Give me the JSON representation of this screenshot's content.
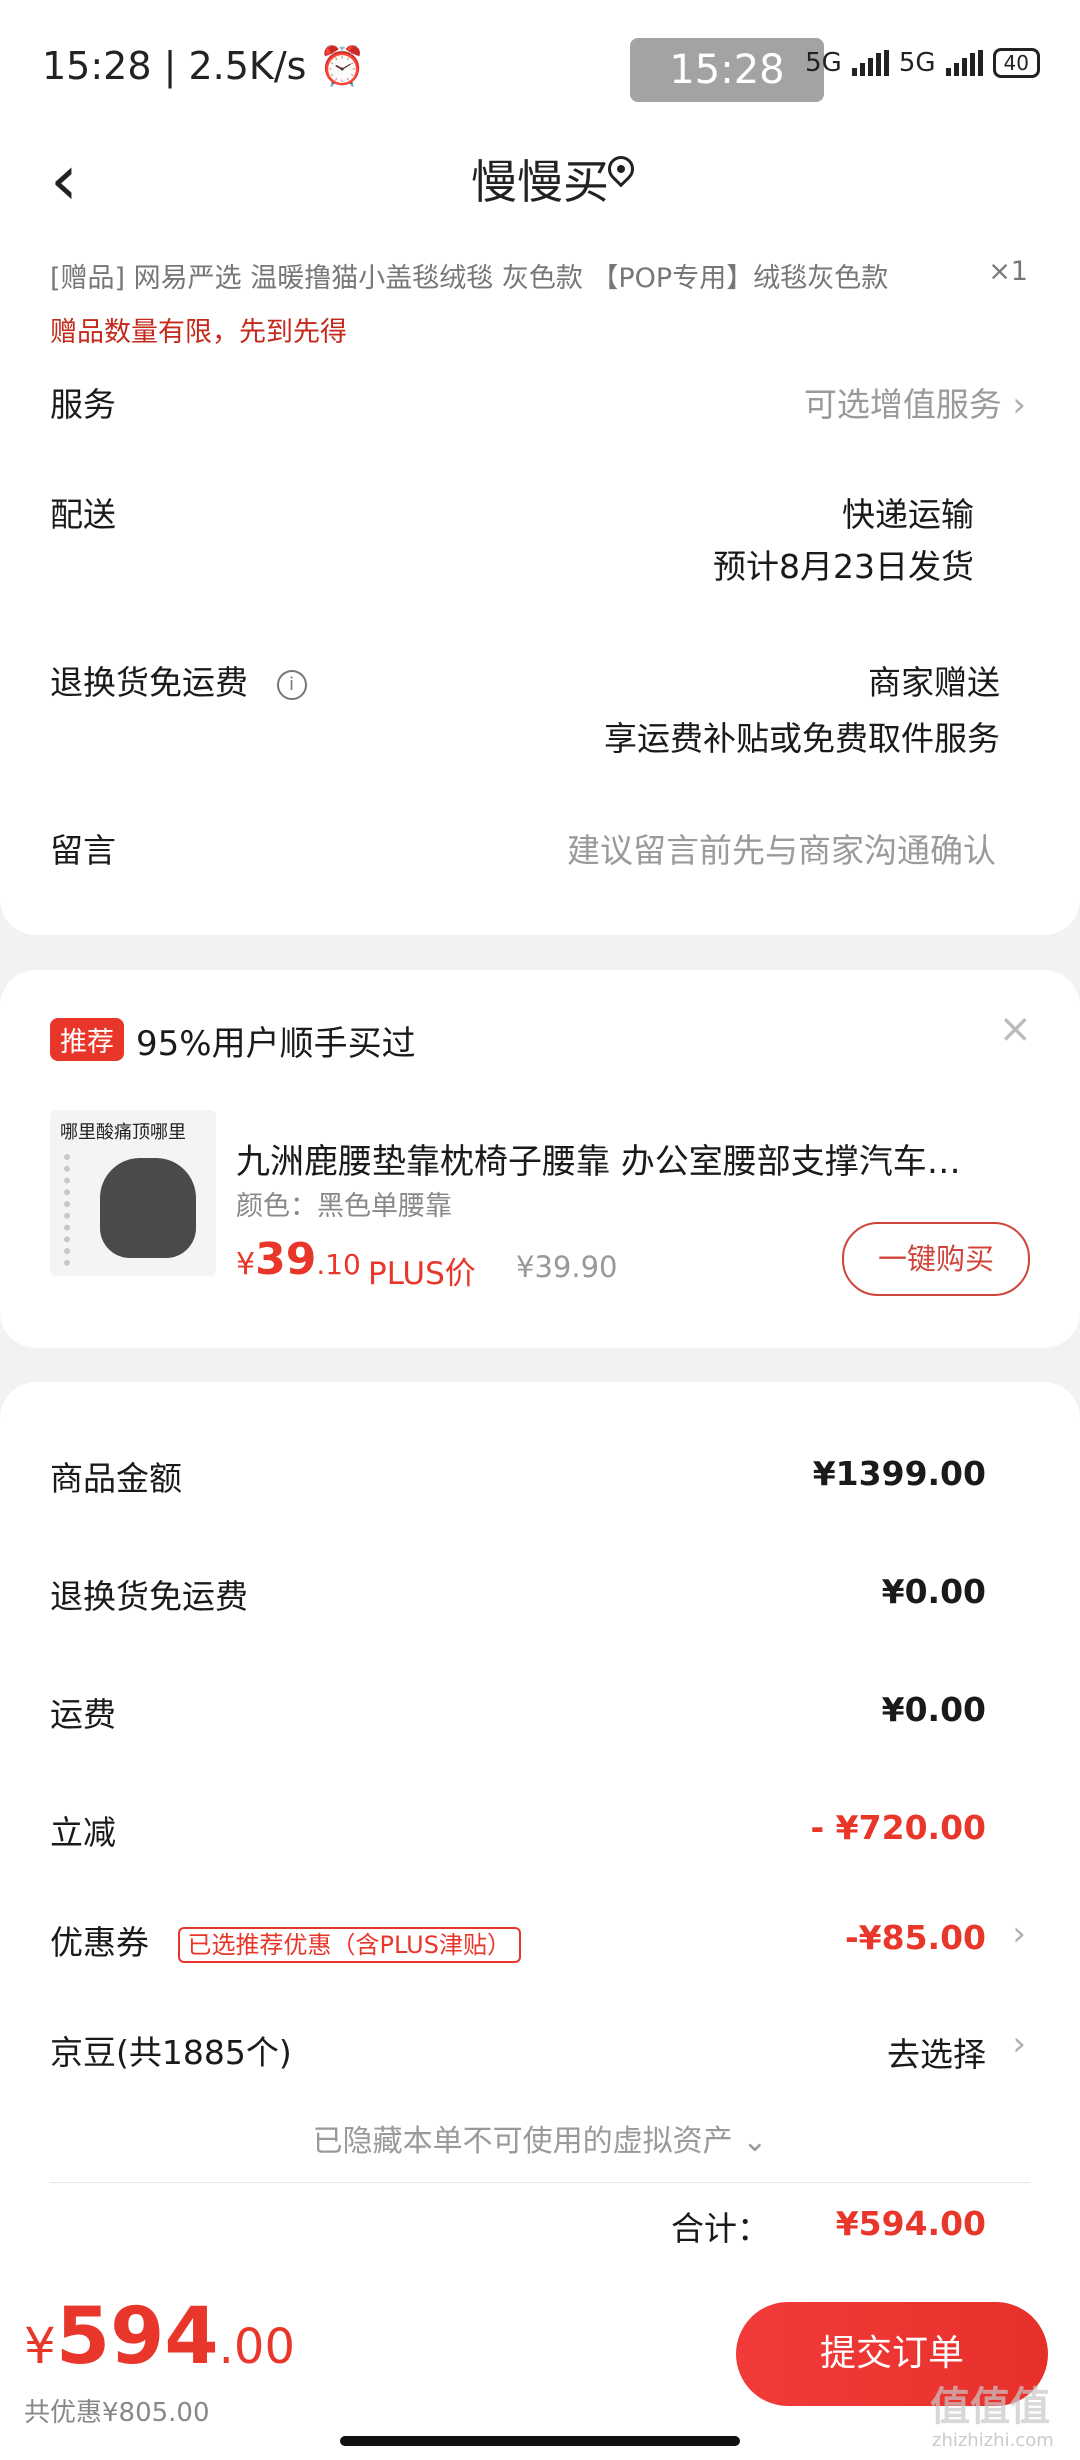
{
  "status_bar": {
    "time": "15:28",
    "speed": "2.5K/s",
    "overlay_time": "15:28",
    "net1": "5G",
    "net2": "5G",
    "battery": "40"
  },
  "header": {
    "title": "慢慢买"
  },
  "gift": {
    "text": "[赠品]   网易严选 温暖撸猫小盖毯绒毯  灰色款 【POP专用】绒毯灰色款",
    "qty": "×1",
    "note": "赠品数量有限，先到先得"
  },
  "rows": {
    "service": {
      "label": "服务",
      "value": "可选增值服务"
    },
    "delivery": {
      "label": "配送",
      "value1": "快递运输",
      "value2": "预计8月23日发货"
    },
    "return_free": {
      "label": "退换货免运费",
      "info_icon": "i",
      "value1": "商家赠送",
      "value2": "享运费补贴或免费取件服务"
    },
    "message": {
      "label": "留言",
      "placeholder": "建议留言前先与商家沟通确认"
    }
  },
  "recommend": {
    "badge": "推荐",
    "title": "95%用户顺手买过",
    "close": "×",
    "thumb_text": "哪里酸痛顶哪里",
    "product_name": "九洲鹿腰垫靠枕椅子腰靠 办公室腰部支撑汽车…",
    "product_color": "颜色：黑色单腰靠",
    "price_yen": "¥",
    "price_int": "39",
    "price_dec": ".10",
    "plus_label": "PLUS价",
    "orig_price": "¥39.90",
    "buy_button": "一键购买"
  },
  "amounts": {
    "goods": {
      "label": "商品金额",
      "value": "¥1399.00"
    },
    "return_free": {
      "label": "退换货免运费",
      "value": "¥0.00"
    },
    "shipping": {
      "label": "运费",
      "value": "¥0.00"
    },
    "discount": {
      "label": "立减",
      "value": "- ¥720.00"
    },
    "coupon": {
      "label": "优惠券",
      "tag": "已选推荐优惠（含PLUS津贴）",
      "value": "-¥85.00"
    },
    "jingdou": {
      "label": "京豆(共1885个)",
      "value": "去选择"
    },
    "hidden_assets": "已隐藏本单不可使用的虚拟资产 ⌄",
    "total_label": "合计：",
    "total_value": "¥594.00"
  },
  "bottom": {
    "yen": "¥",
    "int": "594",
    "dec": ".00",
    "saved": "共优惠¥805.00",
    "submit": "提交订单",
    "watermark": "值值值",
    "watermark_url": "zhizhizhi.com"
  },
  "colors": {
    "accent": "#e8372a",
    "gray_text": "#9a9a9a",
    "background": "#f2f2f2"
  }
}
